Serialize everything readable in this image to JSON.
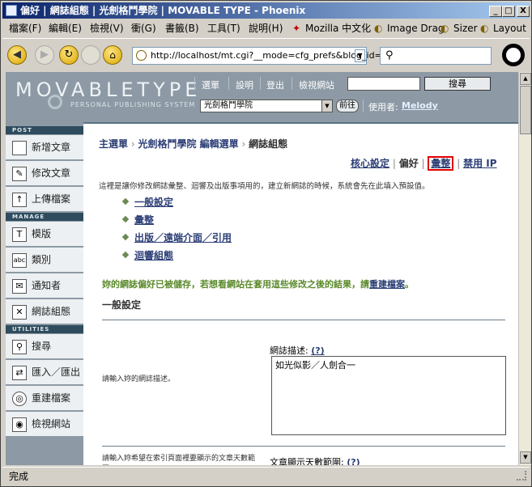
{
  "window": {
    "title": "偏好 | 網誌組態 | 光劍格鬥學院 | MOVABLE TYPE - Phoenix",
    "min": "_",
    "max": "□",
    "close": "X"
  },
  "menu": [
    "檔案(F)",
    "編輯(E)",
    "檢視(V)",
    "衝(G)",
    "書籤(B)",
    "工具(T)",
    "說明(H)",
    "Mozilla 中文化",
    "Image Drag",
    "Sizer",
    "Layout"
  ],
  "address": {
    "url": "http://localhost/mt.cgi?__mode=cfg_prefs&blog_id=1"
  },
  "status": {
    "text": "完成"
  },
  "mt": {
    "logo": "MOVABLETYPE",
    "logo_sub": "PERSONAL PUBLISHING SYSTEM",
    "top_links": [
      "選單",
      "設明",
      "登出",
      "檢視網站"
    ],
    "search_button": "搜尋",
    "blog_select": "光劍格鬥學院",
    "go_button": "前往",
    "user_label": "使用者:",
    "user_name": "Melody"
  },
  "sidebar": {
    "sections": [
      "POST",
      "MANAGE",
      "UTILITIES"
    ],
    "items": [
      {
        "label": "新增文章",
        "icon": "document-icon"
      },
      {
        "label": "修改文章",
        "icon": "edit-icon"
      },
      {
        "label": "上傳檔案",
        "icon": "upload-icon"
      },
      {
        "label": "模版",
        "icon": "template-icon"
      },
      {
        "label": "類別",
        "icon": "category-icon"
      },
      {
        "label": "通知者",
        "icon": "notify-icon"
      },
      {
        "label": "網誌組態",
        "icon": "tools-icon"
      },
      {
        "label": "搜尋",
        "icon": "search-icon"
      },
      {
        "label": "匯入／匯出",
        "icon": "import-export-icon"
      },
      {
        "label": "重建檔案",
        "icon": "rebuild-icon"
      },
      {
        "label": "檢視網站",
        "icon": "view-site-icon"
      }
    ]
  },
  "breadcrumb": [
    "主選單",
    "光劍格鬥學院 編輯選單",
    "網誌組態"
  ],
  "tabs": [
    "核心設定",
    "偏好",
    "彙整",
    "禁用 IP"
  ],
  "intro": "這裡是讓你修改網誌彙整、迴響及出版事項用的，建立新網誌的時候，系統會先在此填入預設值。",
  "subnav": [
    "一般設定",
    "彙整",
    "出版／遠端介面／引用",
    "迴響組態"
  ],
  "message": {
    "text": "妳的網誌偏好已被儲存，若想看網站在套用這些修改之後的結果，請",
    "link": "重建檔案",
    "end": "。"
  },
  "section_title": "一般設定",
  "field1": {
    "label": "網誌描述:",
    "help": "(?)",
    "value": "如光似影／人劍合一",
    "hint": "請輸入妳的網誌描述。"
  },
  "field2": {
    "label": "文章顯示天數範圍:",
    "help": "(?)",
    "hint": "請輸入妳希望在索引頁面裡要顯示的文章天數範圍。"
  }
}
